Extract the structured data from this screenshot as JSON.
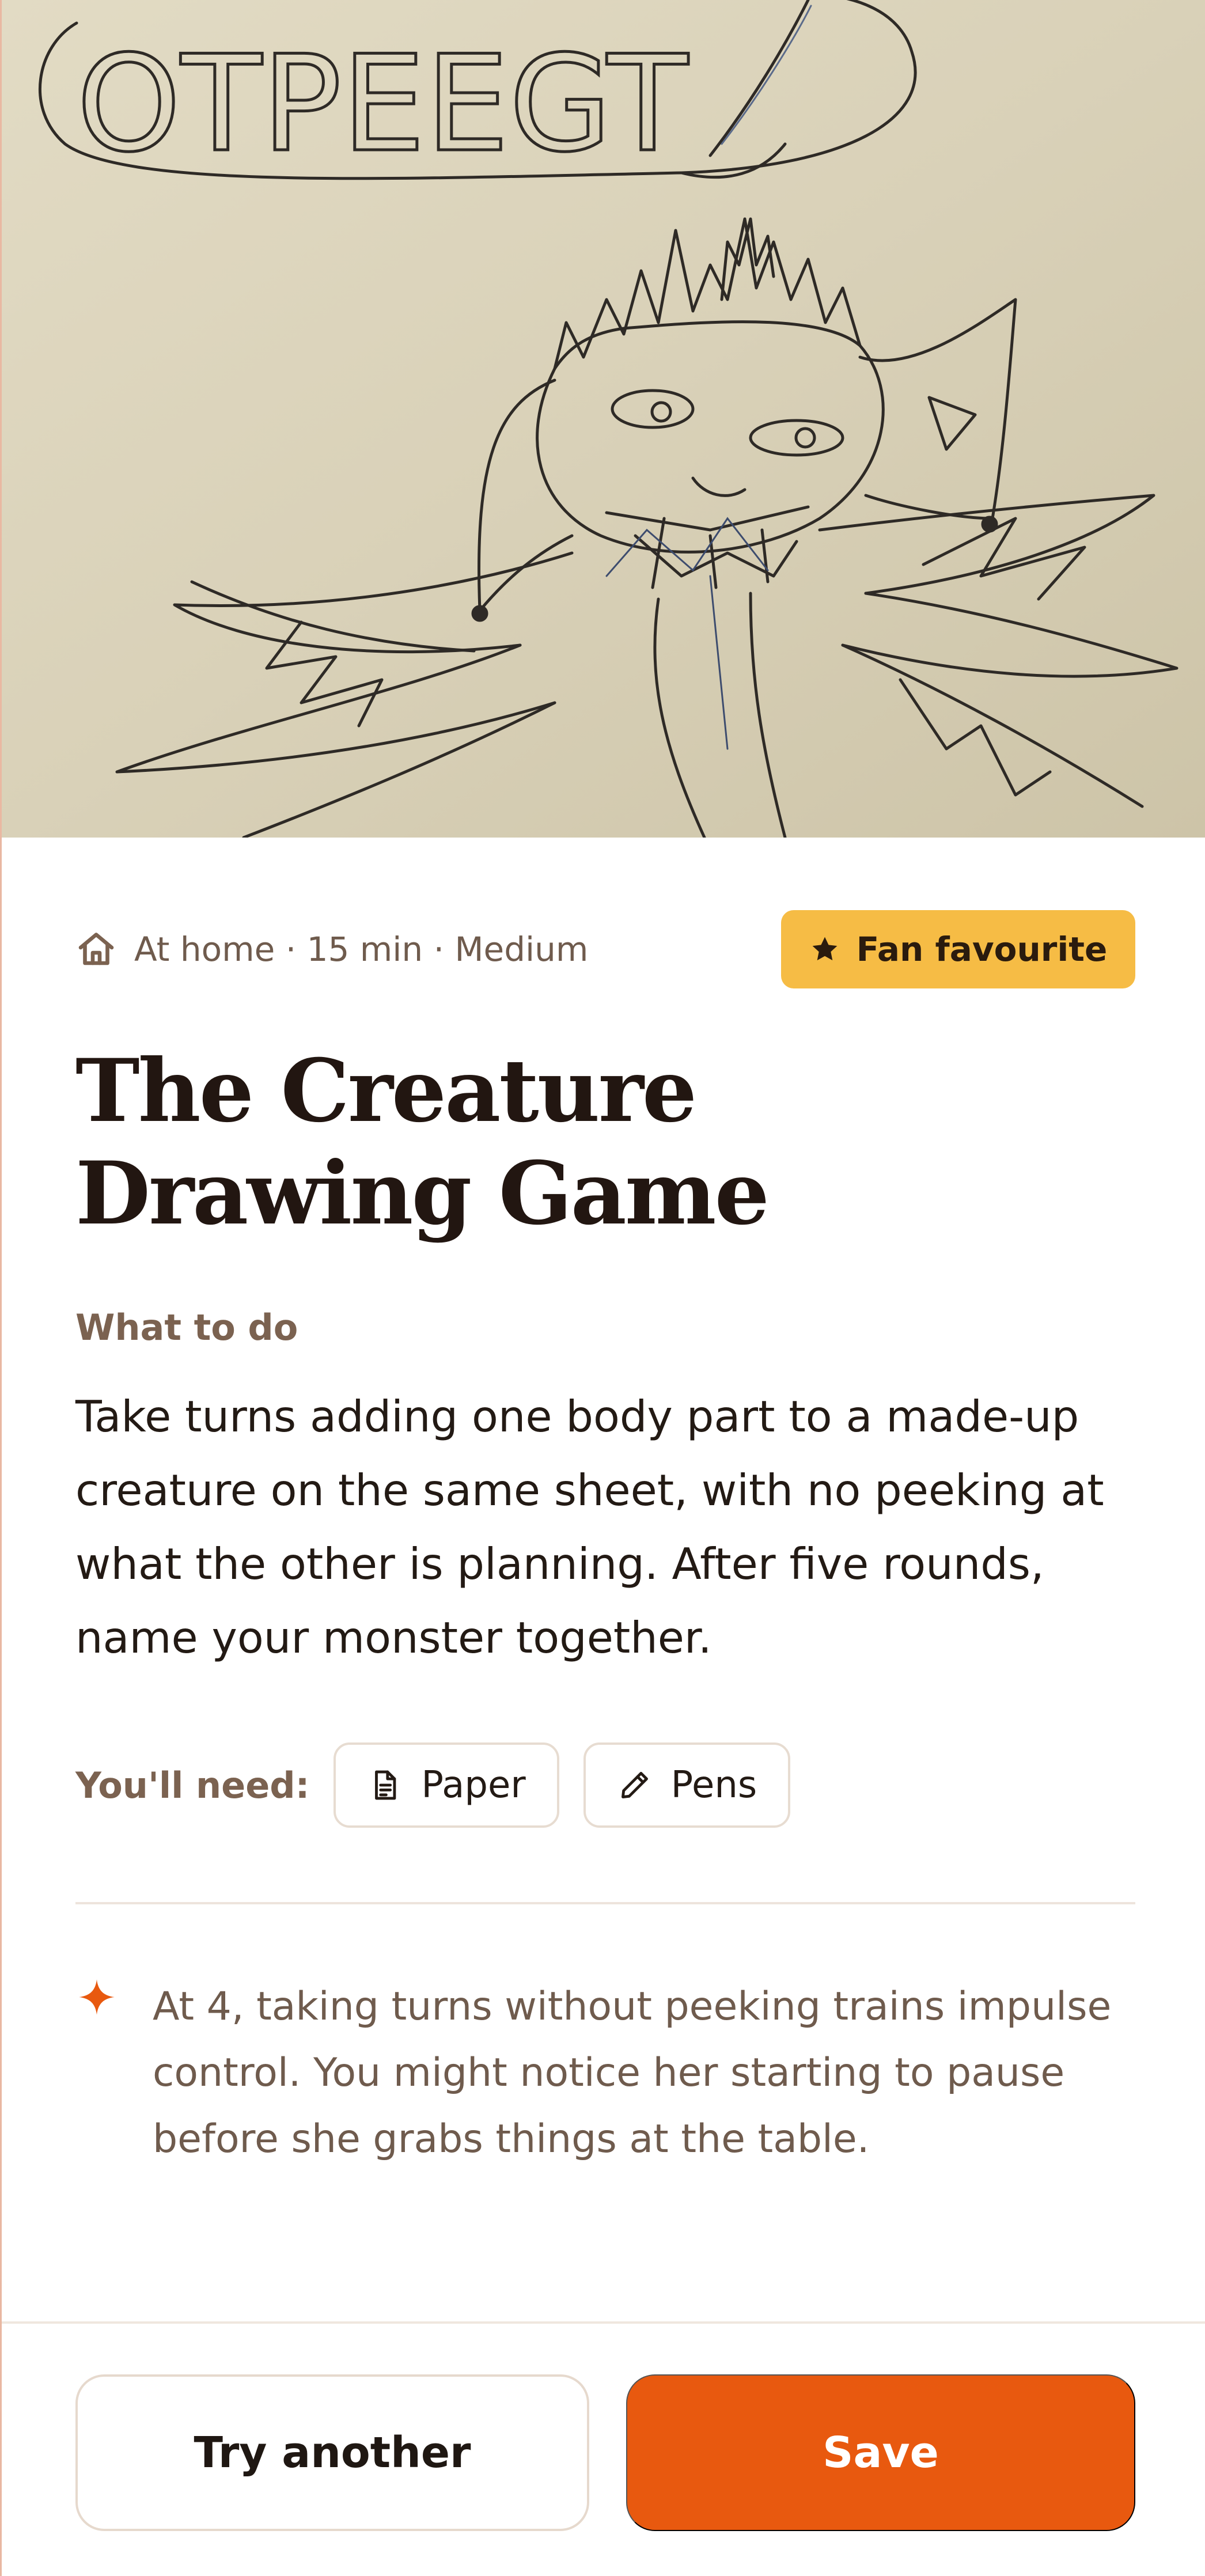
{
  "hero": {
    "image_icon": "child-creature-drawing",
    "drawing_text": "OTPEEGT"
  },
  "meta": {
    "icon": "home-icon",
    "text": "At home · 15 min · Medium"
  },
  "badge": {
    "icon": "star-icon",
    "label": "Fan favourite",
    "color": "#f6bc45"
  },
  "activity": {
    "title_line1": "The Creature",
    "title_line2": "Drawing Game",
    "section_label": "What to do",
    "description": "Take turns adding one body part to a made-up creature on the same sheet, with no peeking at what the other is planning. After five rounds, name your monster together."
  },
  "needs": {
    "label": "You'll need:",
    "items": [
      {
        "icon": "document-icon",
        "label": "Paper"
      },
      {
        "icon": "pencil-icon",
        "label": "Pens"
      }
    ]
  },
  "tip": {
    "icon": "sparkle-icon",
    "text": "At 4, taking turns without peeking trains impulse control. You might notice her starting to pause before she grabs things at the table."
  },
  "actions": {
    "secondary_label": "Try another",
    "primary_label": "Save",
    "primary_color": "#e8590f"
  }
}
